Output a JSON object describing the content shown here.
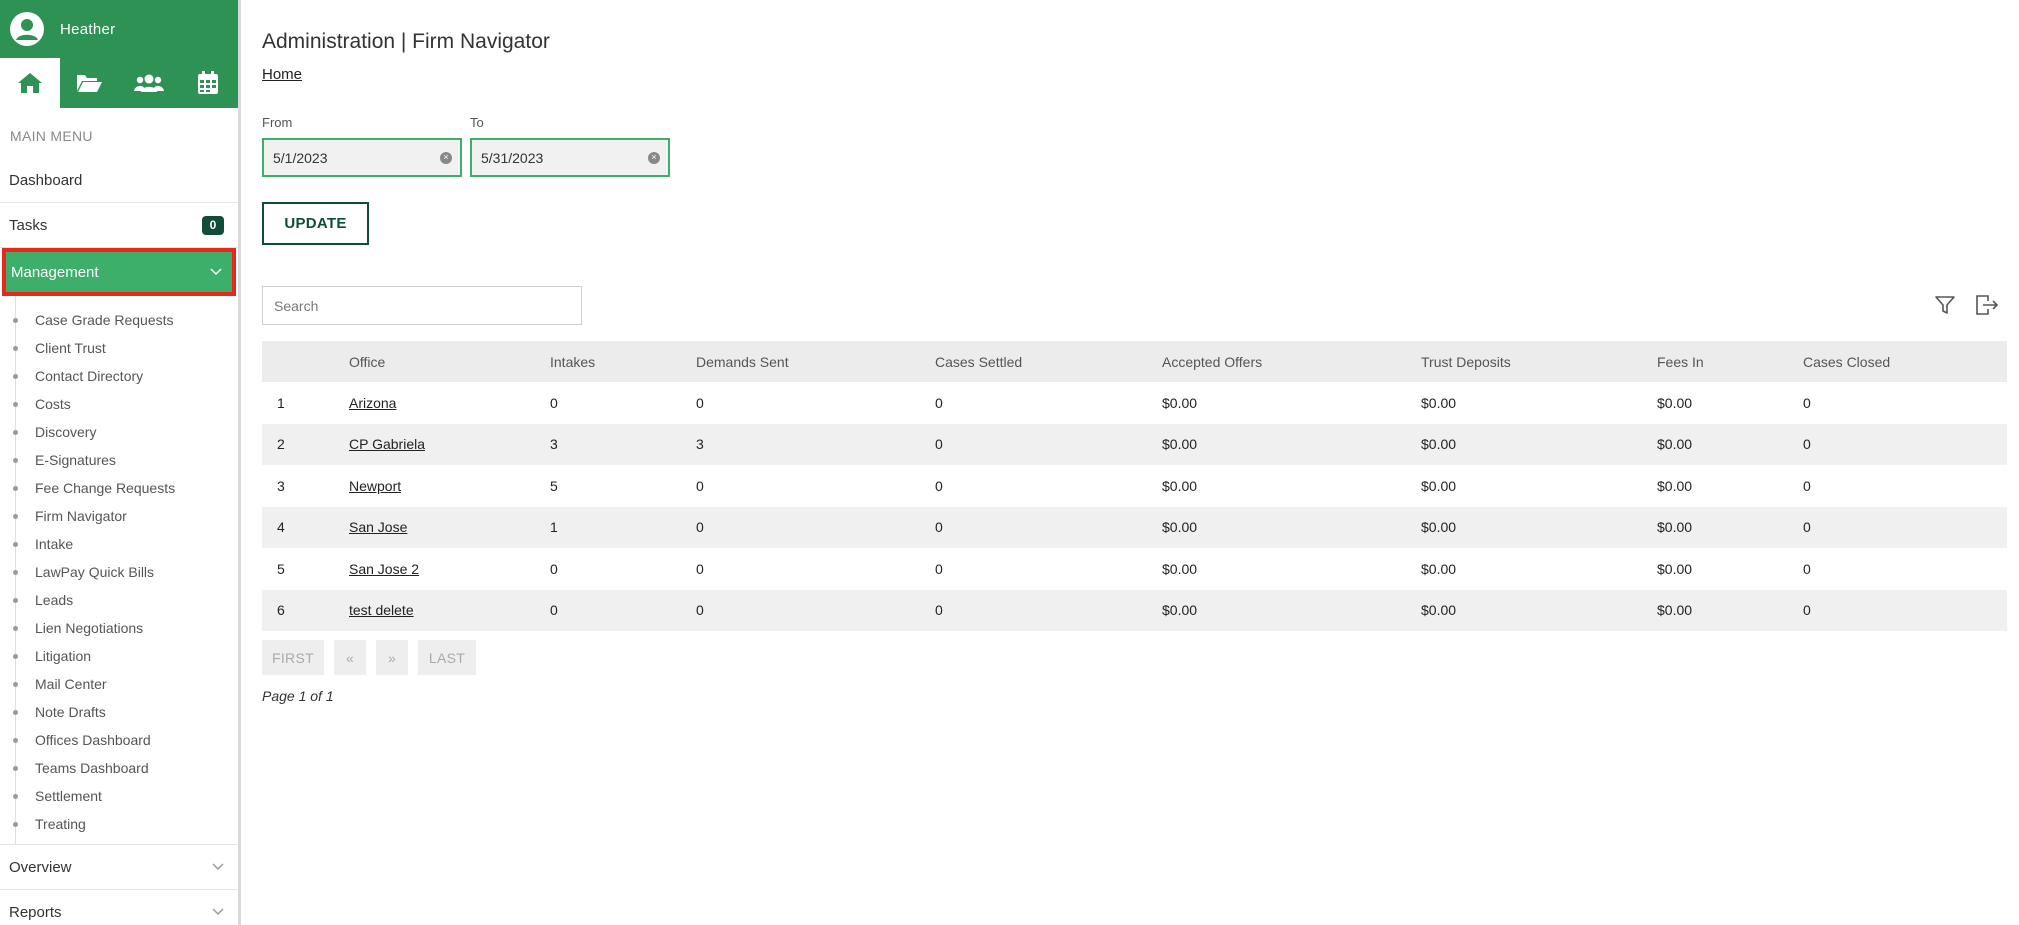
{
  "user": {
    "name": "Heather"
  },
  "sidebar": {
    "main_menu_title": "MAIN MENU",
    "dashboard": "Dashboard",
    "tasks": {
      "label": "Tasks",
      "count": "0"
    },
    "management": {
      "label": "Management",
      "items": [
        "Case Grade Requests",
        "Client Trust",
        "Contact Directory",
        "Costs",
        "Discovery",
        "E-Signatures",
        "Fee Change Requests",
        "Firm Navigator",
        "Intake",
        "LawPay Quick Bills",
        "Leads",
        "Lien Negotiations",
        "Litigation",
        "Mail Center",
        "Note Drafts",
        "Offices Dashboard",
        "Teams Dashboard",
        "Settlement",
        "Treating"
      ]
    },
    "overview": "Overview",
    "reports": "Reports"
  },
  "header": {
    "title": "Administration | Firm Navigator",
    "breadcrumb": "Home"
  },
  "filters": {
    "from_label": "From",
    "from_value": "5/1/2023",
    "to_label": "To",
    "to_value": "5/31/2023",
    "update_label": "UPDATE"
  },
  "search": {
    "placeholder": "Search"
  },
  "table": {
    "headers": [
      "",
      "Office",
      "Intakes",
      "Demands Sent",
      "Cases Settled",
      "Accepted Offers",
      "Trust Deposits",
      "Fees In",
      "Cases Closed"
    ],
    "rows": [
      [
        "1",
        "Arizona",
        "0",
        "0",
        "0",
        "$0.00",
        "$0.00",
        "$0.00",
        "0"
      ],
      [
        "2",
        "CP Gabriela",
        "3",
        "3",
        "0",
        "$0.00",
        "$0.00",
        "$0.00",
        "0"
      ],
      [
        "3",
        "Newport",
        "5",
        "0",
        "0",
        "$0.00",
        "$0.00",
        "$0.00",
        "0"
      ],
      [
        "4",
        "San Jose",
        "1",
        "0",
        "0",
        "$0.00",
        "$0.00",
        "$0.00",
        "0"
      ],
      [
        "5",
        "San Jose 2",
        "0",
        "0",
        "0",
        "$0.00",
        "$0.00",
        "$0.00",
        "0"
      ],
      [
        "6",
        "test delete",
        "0",
        "0",
        "0",
        "$0.00",
        "$0.00",
        "$0.00",
        "0"
      ]
    ]
  },
  "pagination": {
    "first": "FIRST",
    "prev": "«",
    "next": "»",
    "last": "LAST",
    "page_info": "Page 1 of 1"
  },
  "colors": {
    "green": "#2e9255",
    "active_green": "#3daf6a",
    "dark_green": "#0f4c3a",
    "highlight": "#e8281a"
  }
}
